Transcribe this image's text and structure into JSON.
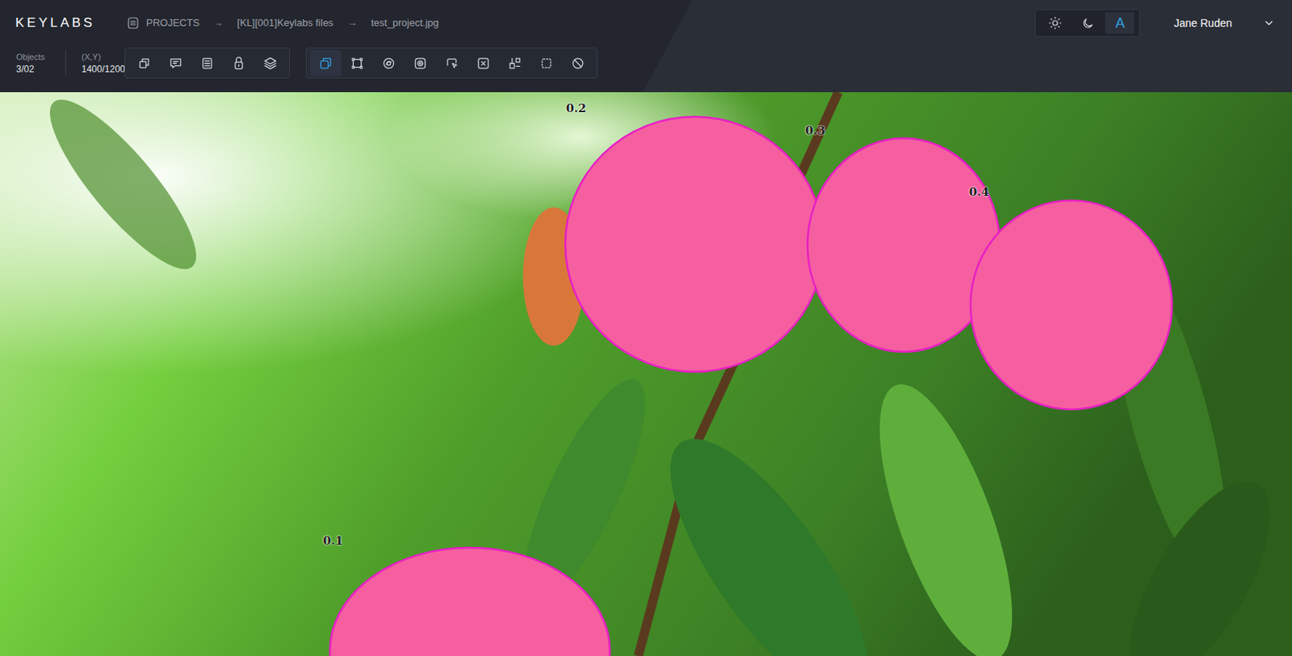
{
  "app": {
    "logo": "KEYLABS"
  },
  "breadcrumb": [
    {
      "label": "PROJECTS"
    },
    {
      "label": "[KL][001]Keylabs files"
    },
    {
      "label": "test_project.jpg"
    }
  ],
  "breadcrumb_separator": "→",
  "theme": [
    {
      "kind": "sun",
      "selected": false
    },
    {
      "kind": "moon",
      "selected": false
    },
    {
      "kind": "letter",
      "label": "A",
      "selected": true
    }
  ],
  "user": {
    "name": "Jane Ruden"
  },
  "stats": [
    {
      "label": "Objects",
      "value": "3/02"
    },
    {
      "label": "(X,Y)",
      "value": "1400/1200"
    }
  ],
  "toolbar_groups": [
    {
      "tools": [
        {
          "selected": false
        },
        {
          "selected": false
        },
        {
          "selected": false
        },
        {
          "selected": false
        },
        {
          "selected": false
        }
      ]
    },
    {
      "tools": [
        {
          "selected": true
        },
        {
          "selected": false
        },
        {
          "selected": false
        },
        {
          "selected": false
        },
        {
          "selected": false
        },
        {
          "selected": false
        },
        {
          "selected": false
        },
        {
          "selected": false
        },
        {
          "selected": false
        }
      ]
    }
  ],
  "objects": [
    {
      "label": "0.2"
    },
    {
      "label": "0.3"
    },
    {
      "label": "0.4"
    },
    {
      "label": "0.1"
    }
  ]
}
